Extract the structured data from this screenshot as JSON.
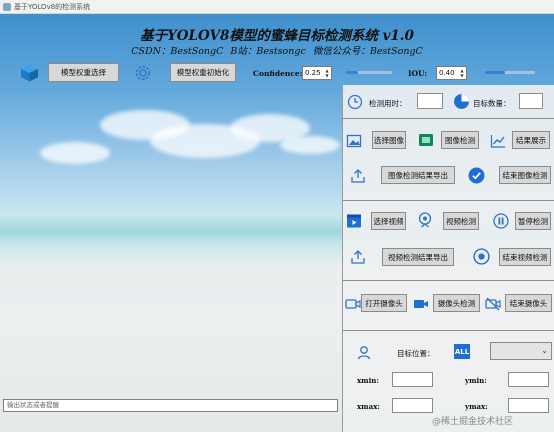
{
  "window": {
    "title": "基于YOLOv8的检测系统"
  },
  "header": {
    "title": "基于YOLOV8模型的蜜蜂目标检测系统 v1.0",
    "subtitle": "CSDN：BestSongC   B站：Bestsongc   微信公众号：BestSongC"
  },
  "toolbar": {
    "select_weights": "模型权重选择",
    "init_weights": "模型权重初始化",
    "confidence_label": "Confidence:",
    "confidence_value": "0.25",
    "confidence_level": 0.25,
    "iou_label": "IOU:",
    "iou_value": "0.40",
    "iou_level": 0.4
  },
  "stats": {
    "time_label": "检测用时：",
    "count_label": "目标数量："
  },
  "image_section": {
    "select": "选择图像",
    "detect": "图像检测",
    "show": "结果展示",
    "export": "图像检测结果导出",
    "end": "结束图像检测"
  },
  "video_section": {
    "select": "选择视频",
    "detect": "视频检测",
    "pause": "暂停检测",
    "export": "视频检测结果导出",
    "end": "结束视频检测"
  },
  "camera_section": {
    "open": "打开摄像头",
    "detect": "摄像头检测",
    "end": "结束摄像头"
  },
  "target": {
    "position_label": "目标位置：",
    "all_badge": "ALL",
    "xmin": "xmin:",
    "ymin": "ymin:",
    "xmax": "xmax:",
    "ymax": "ymax:"
  },
  "status": {
    "text": "输出状态或者提醒"
  },
  "watermark": "@稀土掘金技术社区",
  "colors": {
    "accent": "#1f6fd1",
    "panel": "#eef0f1"
  },
  "icons": [
    "cube-icon",
    "target-gear-icon",
    "clock-icon",
    "pie-chart-icon",
    "image-icon",
    "image-detect-icon",
    "chart-icon",
    "export-icon",
    "check-circle-icon",
    "video-file-icon",
    "webcam-icon",
    "pause-icon",
    "stop-icon",
    "camera-icon",
    "camera-detect-icon",
    "camera-off-icon",
    "location-icon",
    "all-badge"
  ]
}
